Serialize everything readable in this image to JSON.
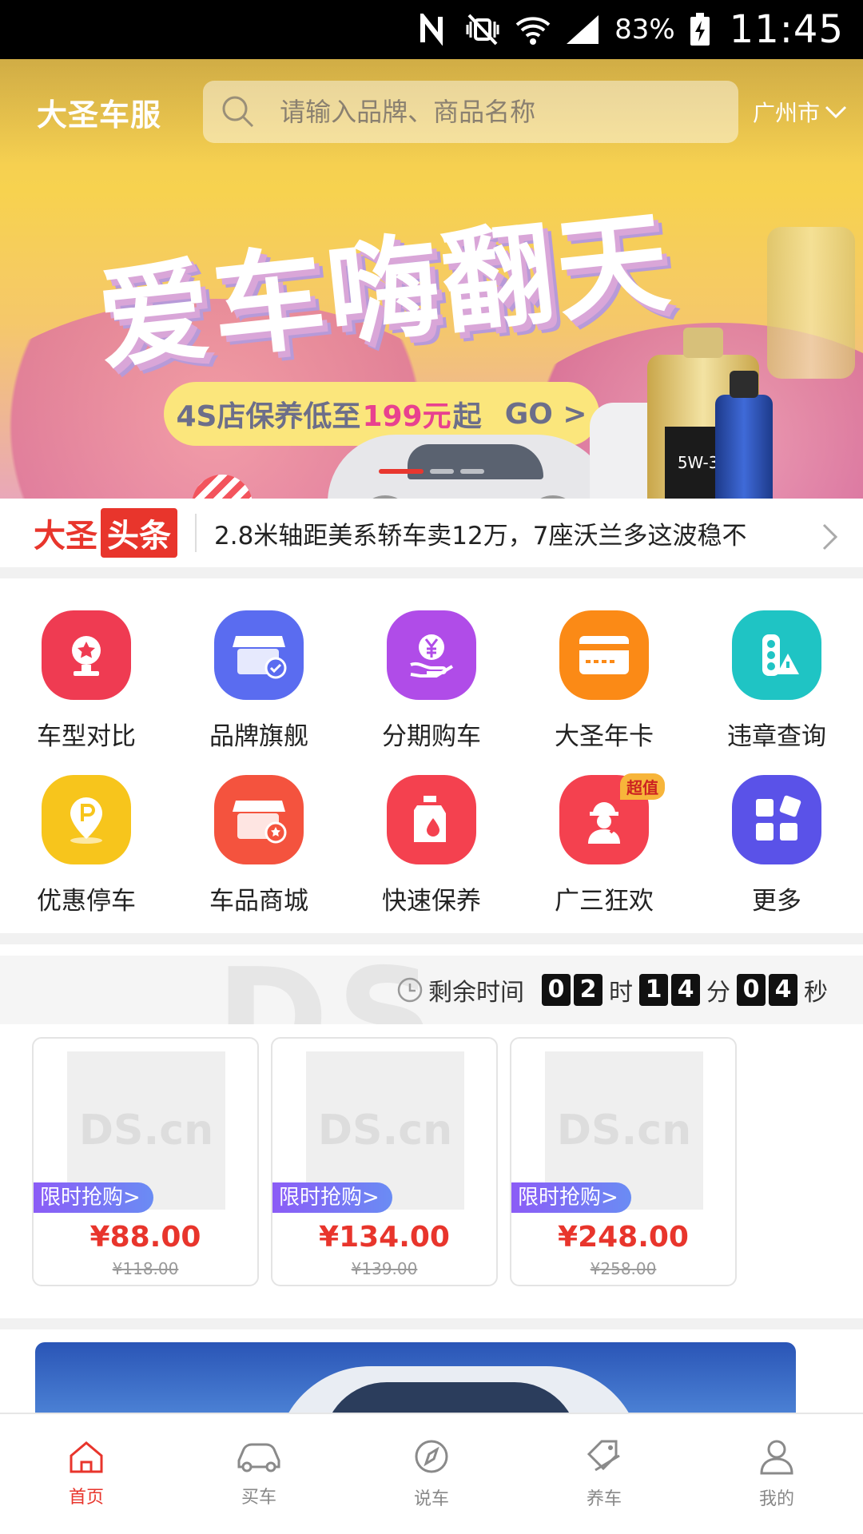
{
  "status_bar": {
    "battery": "83%",
    "time": "11:45"
  },
  "header": {
    "logo": "大圣车服",
    "search_placeholder": "请输入品牌、商品名称",
    "city": "广州市"
  },
  "banner": {
    "headline": "爱车嗨翻天",
    "promo_prefix": "4S店保养低至",
    "promo_price": "199元",
    "promo_suffix": "起",
    "promo_cta": "GO >",
    "bottle_label": "5W-30",
    "active_slide": 1,
    "slide_count": 3
  },
  "news": {
    "brand_part1": "大圣",
    "brand_part2": "头条",
    "headline": "2.8米轴距美系轿车卖12万，7座沃兰多这波稳不"
  },
  "quick_menu": [
    {
      "label": "车型对比",
      "icon": "trophy-icon",
      "color": "#ef3b52"
    },
    {
      "label": "品牌旗舰",
      "icon": "storefront-check-icon",
      "color": "#5a6cf0"
    },
    {
      "label": "分期购车",
      "icon": "yen-hand-icon",
      "color": "#b04ce8"
    },
    {
      "label": "大圣年卡",
      "icon": "card-icon",
      "color": "#fb8a16"
    },
    {
      "label": "违章查询",
      "icon": "traffic-light-icon",
      "color": "#1fc4c4"
    },
    {
      "label": "优惠停车",
      "icon": "parking-pin-icon",
      "color": "#f7c51c"
    },
    {
      "label": "车品商城",
      "icon": "store-star-icon",
      "color": "#f4533e"
    },
    {
      "label": "快速保养",
      "icon": "oil-bottle-icon",
      "color": "#f4414f"
    },
    {
      "label": "广三狂欢",
      "icon": "mechanic-icon",
      "color": "#f4414f",
      "tag": "超值"
    },
    {
      "label": "更多",
      "icon": "grid-more-icon",
      "color": "#5a52e8"
    }
  ],
  "flash_sale": {
    "remaining_label": "剩余时间",
    "hours": [
      "0",
      "2"
    ],
    "minutes": [
      "1",
      "4"
    ],
    "seconds": [
      "0",
      "4"
    ],
    "unit_hour": "时",
    "unit_minute": "分",
    "unit_second": "秒",
    "watermark": "DS"
  },
  "products": [
    {
      "placeholder": "DS.cn",
      "badge": "限时抢购>",
      "price": "¥88.00",
      "original_price": "¥118.00"
    },
    {
      "placeholder": "DS.cn",
      "badge": "限时抢购>",
      "price": "¥134.00",
      "original_price": "¥139.00"
    },
    {
      "placeholder": "DS.cn",
      "badge": "限时抢购>",
      "price": "¥248.00",
      "original_price": "¥258.00"
    }
  ],
  "tab_bar": [
    {
      "label": "首页",
      "icon": "home-icon",
      "active": true
    },
    {
      "label": "买车",
      "icon": "car-icon",
      "active": false
    },
    {
      "label": "说车",
      "icon": "compass-icon",
      "active": false
    },
    {
      "label": "养车",
      "icon": "tag-icon",
      "active": false
    },
    {
      "label": "我的",
      "icon": "person-icon",
      "active": false
    }
  ],
  "colors": {
    "accent": "#e8352c",
    "badge_gradient_start": "#8b5cf6",
    "badge_gradient_end": "#6a8cf4"
  }
}
